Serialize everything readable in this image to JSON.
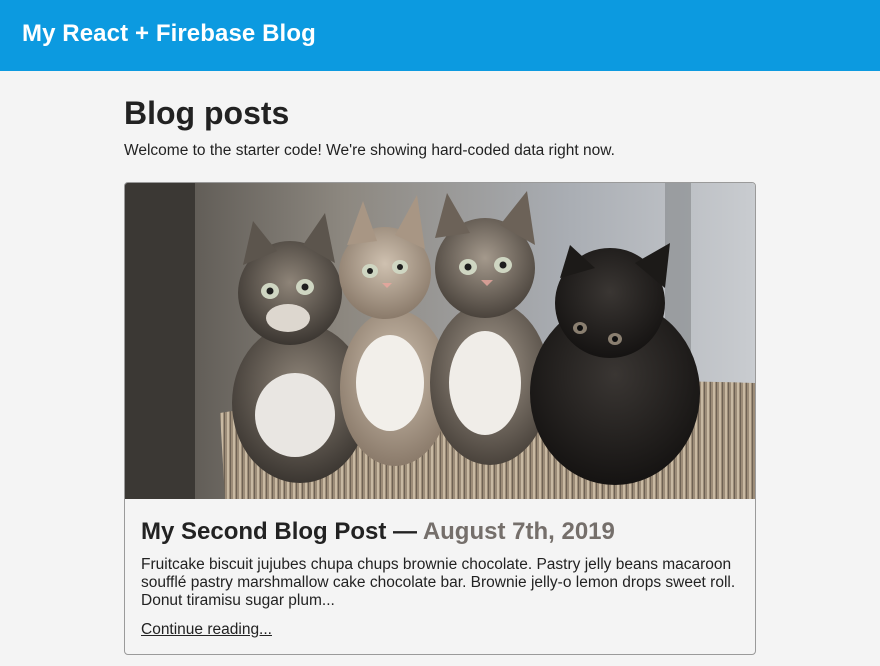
{
  "header": {
    "title": "My React + Firebase Blog",
    "background_color": "#0c9ae0"
  },
  "main": {
    "heading": "Blog posts",
    "intro": "Welcome to the starter code! We're showing hard-coded data right now."
  },
  "posts": [
    {
      "image_name": "kittens-photo",
      "title": "My Second Blog Post",
      "separator": " — ",
      "date": "August 7th, 2019",
      "excerpt": "Fruitcake biscuit jujubes chupa chups brownie chocolate. Pastry jelly beans macaroon soufflé pastry marshmallow cake chocolate bar. Brownie jelly-o lemon drops sweet roll. Donut tiramisu sugar plum...",
      "link_label": "Continue reading..."
    }
  ],
  "colors": {
    "page_background": "#f4f4f4",
    "date_text": "#756f6b",
    "text": "#222222"
  }
}
